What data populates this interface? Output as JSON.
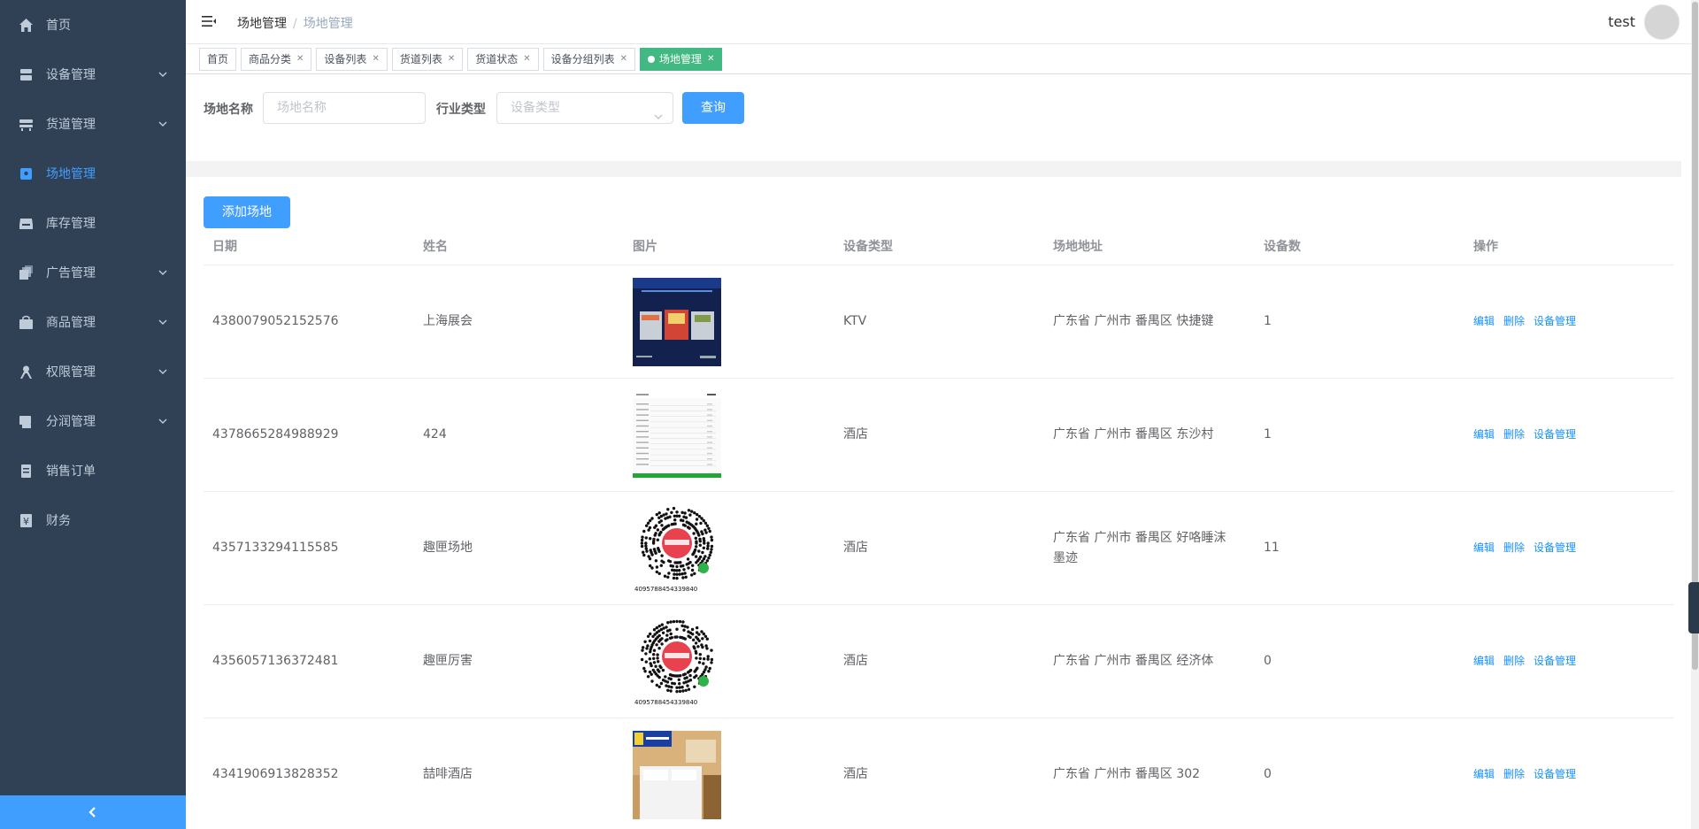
{
  "sidebar": {
    "items": [
      {
        "label": "首页",
        "icon": "home-icon",
        "has_arrow": false
      },
      {
        "label": "设备管理",
        "icon": "device-icon",
        "has_arrow": true
      },
      {
        "label": "货道管理",
        "icon": "cargo-lane-icon",
        "has_arrow": true
      },
      {
        "label": "场地管理",
        "icon": "venue-icon",
        "has_arrow": false,
        "active": true
      },
      {
        "label": "库存管理",
        "icon": "inventory-icon",
        "has_arrow": false
      },
      {
        "label": "广告管理",
        "icon": "ad-icon",
        "has_arrow": true
      },
      {
        "label": "商品管理",
        "icon": "goods-icon",
        "has_arrow": true
      },
      {
        "label": "权限管理",
        "icon": "permission-icon",
        "has_arrow": true
      },
      {
        "label": "分润管理",
        "icon": "profit-share-icon",
        "has_arrow": true
      },
      {
        "label": "销售订单",
        "icon": "order-icon",
        "has_arrow": false
      },
      {
        "label": "财务",
        "icon": "finance-icon",
        "has_arrow": false
      }
    ],
    "colors": {
      "bg": "#304156",
      "text": "#bfcbd9",
      "active": "#409eff"
    }
  },
  "header": {
    "breadcrumb": [
      "场地管理",
      "场地管理"
    ],
    "user": "test"
  },
  "tags": [
    {
      "label": "首页",
      "closable": false
    },
    {
      "label": "商品分类",
      "closable": true
    },
    {
      "label": "设备列表",
      "closable": true
    },
    {
      "label": "货道列表",
      "closable": true
    },
    {
      "label": "货道状态",
      "closable": true
    },
    {
      "label": "设备分组列表",
      "closable": true
    },
    {
      "label": "场地管理",
      "closable": true,
      "active": true
    }
  ],
  "filter": {
    "name_label": "场地名称",
    "name_placeholder": "场地名称",
    "type_label": "行业类型",
    "type_placeholder": "设备类型",
    "search_button": "查询"
  },
  "add_button": "添加场地",
  "table": {
    "columns": [
      "日期",
      "姓名",
      "图片",
      "设备类型",
      "场地地址",
      "设备数",
      "操作"
    ],
    "rows": [
      {
        "date": "4380079052152576",
        "name": "上海展会",
        "image": "blue-screen-image",
        "type": "KTV",
        "address": "广东省 广州市 番禺区 快捷键",
        "count": "1"
      },
      {
        "date": "4378665284988929",
        "name": "424",
        "image": "document-screenshot-image",
        "type": "酒店",
        "address": "广东省 广州市 番禺区 东沙村",
        "count": "1"
      },
      {
        "date": "4357133294115585",
        "name": "趣匣场地",
        "image": "mini-program-code-image",
        "image_caption": "4095788454339840",
        "type": "酒店",
        "address": "广东省 广州市 番禺区 好咯睡沫墨迹",
        "count": "11"
      },
      {
        "date": "4356057136372481",
        "name": "趣匣厉害",
        "image": "mini-program-code-image",
        "image_caption": "4095788454339840",
        "type": "酒店",
        "address": "广东省 广州市 番禺区 经济体",
        "count": "0"
      },
      {
        "date": "4341906913828352",
        "name": "喆啡酒店",
        "image": "hotel-room-image",
        "type": "酒店",
        "address": "广东省 广州市 番禺区 302",
        "count": "0"
      }
    ],
    "actions": [
      "编辑",
      "删除",
      "设备管理"
    ]
  }
}
